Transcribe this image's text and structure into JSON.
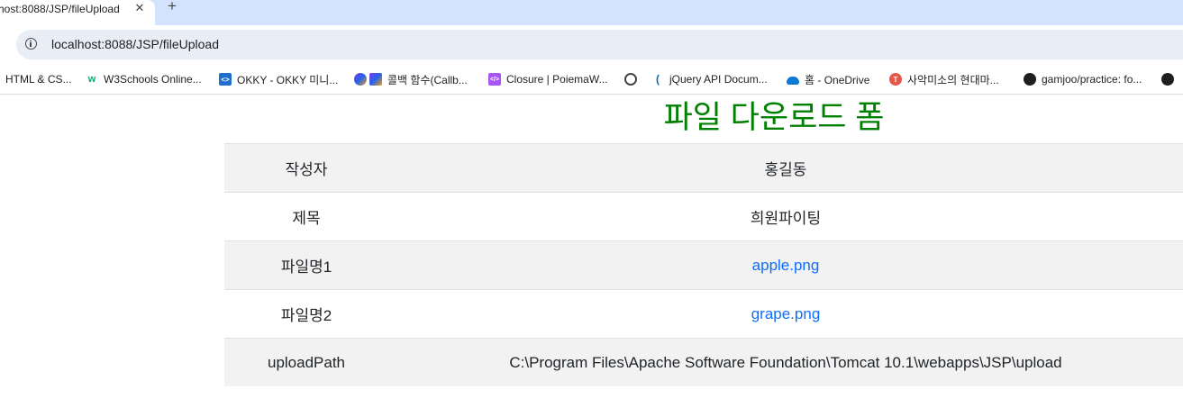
{
  "browser": {
    "tab": {
      "title": "host:8088/JSP/fileUpload",
      "close_glyph": "✕"
    },
    "new_tab_glyph": "+",
    "address_bar": {
      "url": "localhost:8088/JSP/fileUpload",
      "icon": "info-icon"
    },
    "bookmarks": [
      {
        "label": "HTML & CS...",
        "icon": "none"
      },
      {
        "label": "W3Schools Online...",
        "icon": "w3schools-icon"
      },
      {
        "label": "OKKY - OKKY 미니...",
        "icon": "okky-icon"
      },
      {
        "label": "콜백 함수(Callb...",
        "icon": "callback-icon"
      },
      {
        "label": "Closure | PoiemaW...",
        "icon": "poiemaweb-icon"
      },
      {
        "label": "",
        "icon": "globe-icon"
      },
      {
        "label": "jQuery API Docum...",
        "icon": "jquery-icon"
      },
      {
        "label": "홈 - OneDrive",
        "icon": "onedrive-icon"
      },
      {
        "label": "사악미소의 현대마...",
        "icon": "blog-icon"
      },
      {
        "label": "gamjoo/practice: fo...",
        "icon": "github-icon"
      }
    ]
  },
  "page": {
    "heading": "파일 다운로드 폼",
    "rows": [
      {
        "label": "작성자",
        "value": "홍길동",
        "is_link": false
      },
      {
        "label": "제목",
        "value": "희원파이팅",
        "is_link": false
      },
      {
        "label": "파일명1",
        "value": "apple.png",
        "is_link": true
      },
      {
        "label": "파일명2",
        "value": "grape.png",
        "is_link": true
      },
      {
        "label": "uploadPath",
        "value": "C:\\Program Files\\Apache Software Foundation\\Tomcat 10.1\\webapps\\JSP\\upload",
        "is_link": false
      }
    ]
  },
  "colors": {
    "heading": "#008000",
    "link": "#0d6efd",
    "stripe": "#f2f2f2",
    "tabstrip": "#d3e3fd"
  }
}
